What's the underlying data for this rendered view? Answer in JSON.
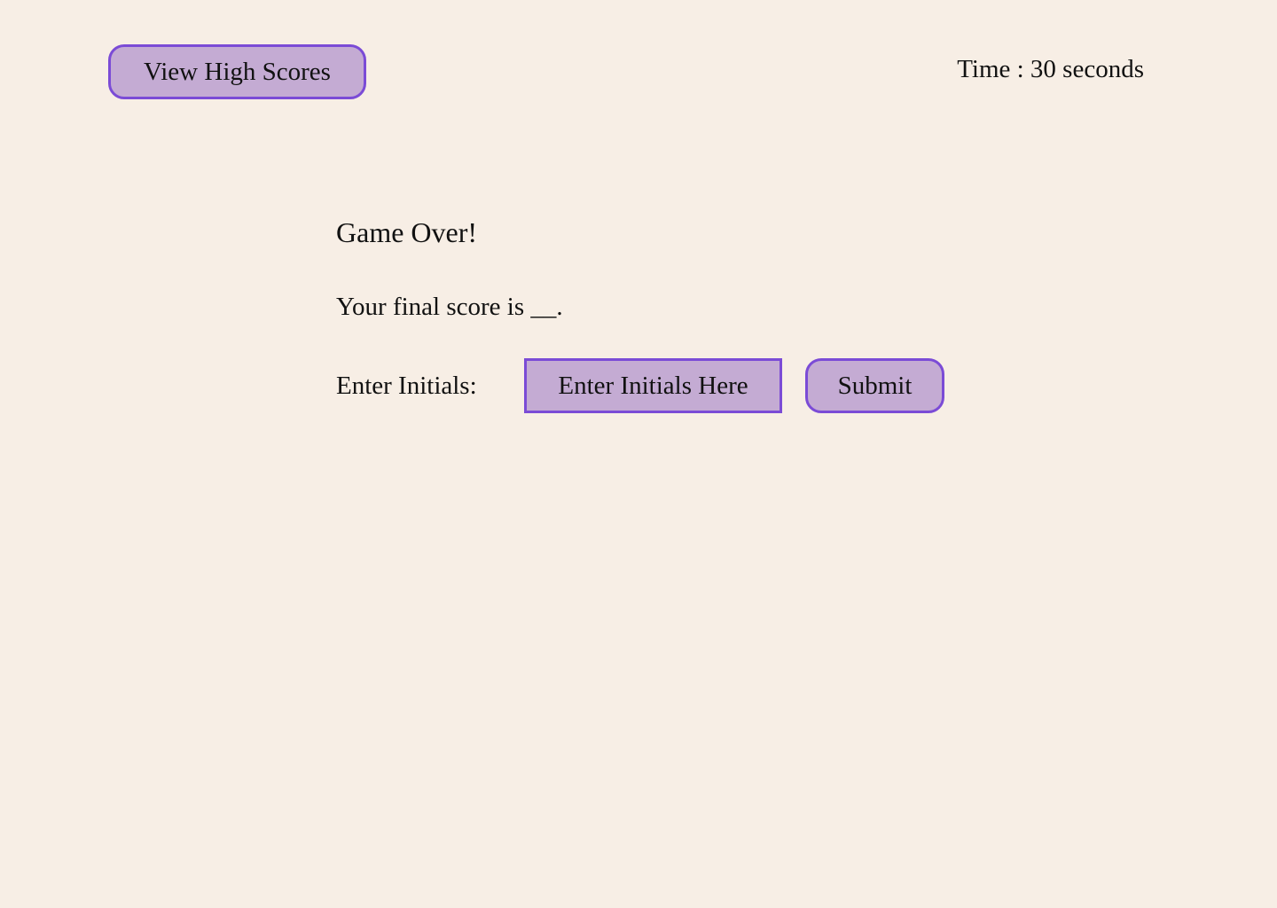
{
  "header": {
    "high_scores_label": "View High Scores",
    "timer_text": "Time : 30 seconds"
  },
  "main": {
    "title": "Game Over!",
    "score_text": "Your final score is __.",
    "initials_label": "Enter Initials:",
    "initials_placeholder": "Enter Initials Here",
    "initials_value": "",
    "submit_label": "Submit"
  },
  "colors": {
    "background": "#f7eee5",
    "button_fill": "#c4abd3",
    "button_border": "#7b4bd6",
    "text": "#111111"
  }
}
